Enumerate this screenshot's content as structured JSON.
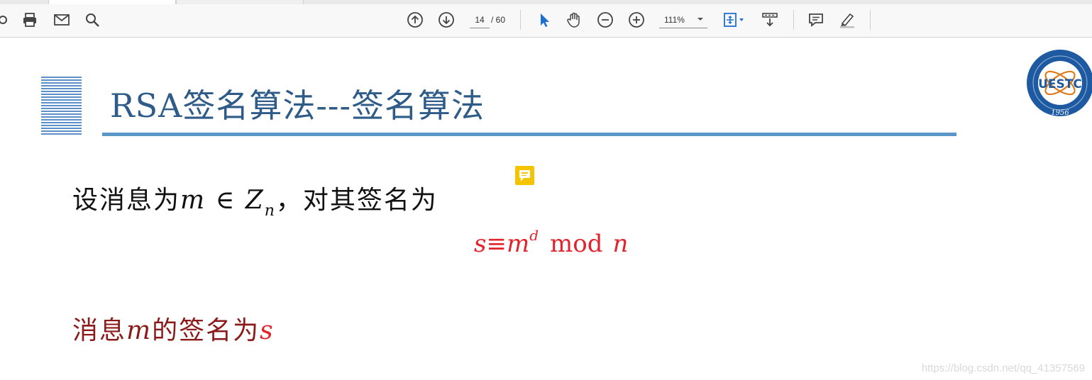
{
  "toolbar": {
    "page_current": "14",
    "page_total": "/ 60",
    "zoom": "111%",
    "icons": [
      "link-icon",
      "print-icon",
      "email-icon",
      "search-icon",
      "arrow-up-icon",
      "arrow-down-icon",
      "select-cursor-icon",
      "hand-icon",
      "zoom-out-icon",
      "zoom-in-icon",
      "fit-page-icon",
      "scroll-mode-icon",
      "comment-icon",
      "highlight-icon"
    ],
    "accent_color": "#1f6fce"
  },
  "slide": {
    "title": "RSA签名算法---签名算法",
    "line1_prefix": "设消息为",
    "line1_m": "m",
    "line1_in": "∈",
    "line1_Z": "Z",
    "line1_n": "n",
    "line1_suffix": "，对其签名为",
    "formula_s": "s",
    "formula_equiv": "≡",
    "formula_m": "m",
    "formula_d": "d",
    "formula_mod": "mod",
    "formula_n": "n",
    "line3_prefix": "消息",
    "line3_m": "m",
    "line3_mid": "的签名为",
    "line3_s": "s",
    "title_color": "#2e5b87",
    "formula_color": "#e3232b"
  },
  "logo": {
    "text": "UESTC",
    "year": "1956"
  },
  "watermark": "https://blog.csdn.net/qq_41357569"
}
